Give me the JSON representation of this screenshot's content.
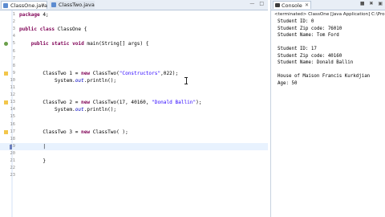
{
  "editor": {
    "tabs": [
      {
        "label": "ClassOne.java",
        "close": "✕"
      },
      {
        "label": "ClassTwo.java",
        "close": ""
      }
    ],
    "window_buttons": "— □",
    "lines": [
      {
        "n": "1",
        "text": "package homework4;"
      },
      {
        "n": "2",
        "text": ""
      },
      {
        "n": "3",
        "text": "public class ClassOne {"
      },
      {
        "n": "4",
        "text": ""
      },
      {
        "n": "5",
        "text": "    public static void main(String[] args) {"
      },
      {
        "n": "6",
        "text": ""
      },
      {
        "n": "7",
        "text": ""
      },
      {
        "n": "8",
        "text": ""
      },
      {
        "n": "9",
        "text": "        ClassTwo obj1 = new ClassTwo(\"Constructors\",022);"
      },
      {
        "n": "10",
        "text": "            System.out.println();"
      },
      {
        "n": "11",
        "text": ""
      },
      {
        "n": "12",
        "text": ""
      },
      {
        "n": "13",
        "text": "        ClassTwo obj2 = new ClassTwo(17, 40160, \"Donald Ballin\");"
      },
      {
        "n": "14",
        "text": "            System.out.println();"
      },
      {
        "n": "15",
        "text": ""
      },
      {
        "n": "16",
        "text": ""
      },
      {
        "n": "17",
        "text": "        ClassTwo obj3 = new ClassTwo( );"
      },
      {
        "n": "18",
        "text": ""
      },
      {
        "n": "19",
        "text": "        |"
      },
      {
        "n": "20",
        "text": ""
      },
      {
        "n": "21",
        "text": "        }"
      },
      {
        "n": "22",
        "text": ""
      },
      {
        "n": "23",
        "text": ""
      }
    ]
  },
  "console": {
    "tab_label": "Console",
    "tab_close": "✕",
    "buttons": "■ ✖ ▣",
    "status": "<terminated> ClassOne [Java Application] C:\\Pro",
    "output": [
      "Student ID: 0",
      "Student Zip code: 76010",
      "Student Name: Tom Ford",
      "",
      "Student ID: 17",
      "Student Zip code: 40160",
      "Student Name: Donald Ballin",
      "",
      "House of Maison Francis Kurkdjian",
      "Age: 50"
    ]
  }
}
